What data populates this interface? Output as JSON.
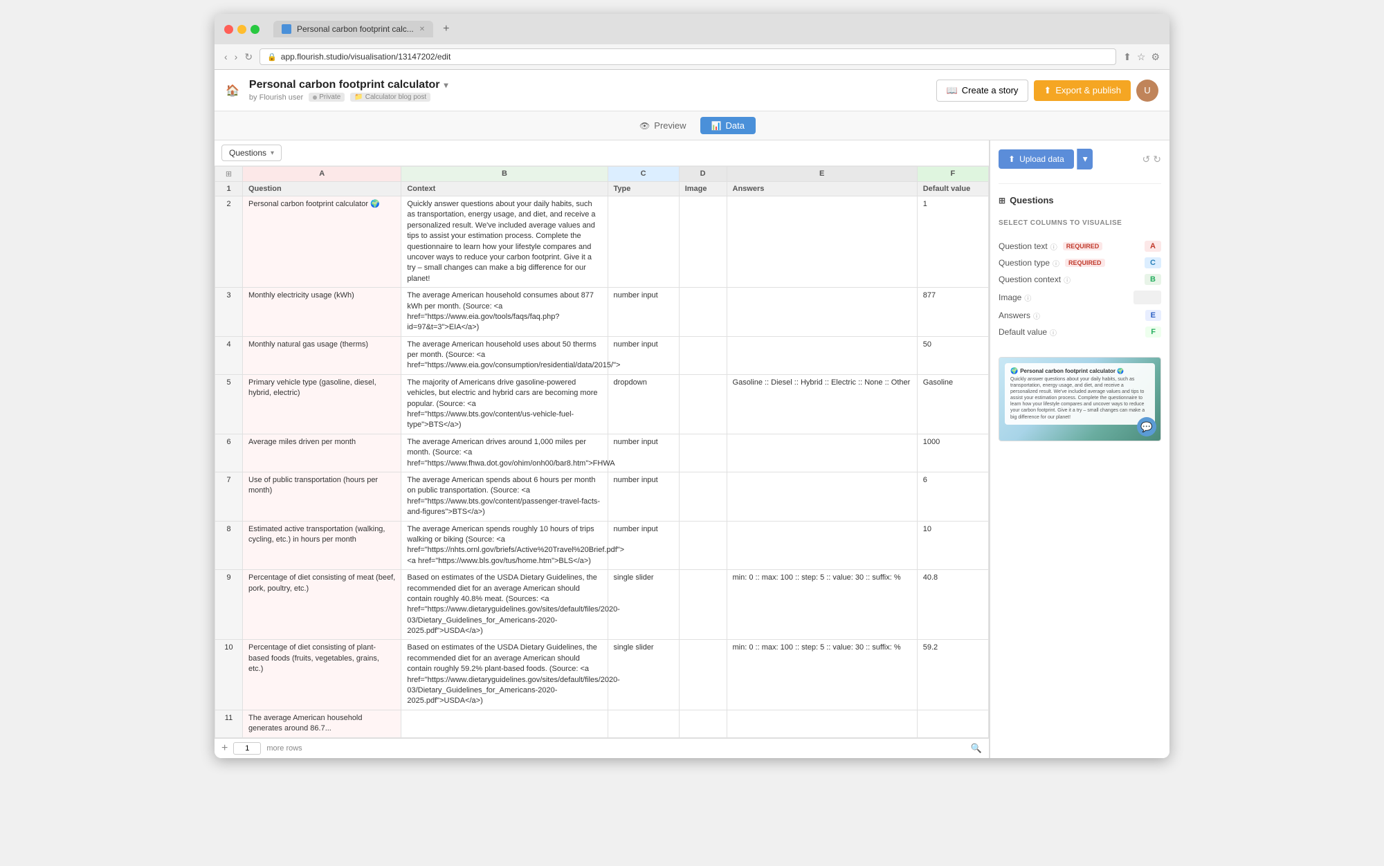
{
  "browser": {
    "url": "app.flourish.studio/visualisation/13147202/edit",
    "tab_title": "Personal carbon footprint calc...",
    "traffic_lights": [
      "red",
      "yellow",
      "green"
    ]
  },
  "header": {
    "project_title": "Personal carbon footprint calculator",
    "by_label": "by Flourish user",
    "private_badge": "Private",
    "folder_badge": "Calculator blog post",
    "create_story_label": "Create a story",
    "export_publish_label": "Export & publish"
  },
  "view_tabs": [
    {
      "id": "preview",
      "label": "Preview",
      "icon": "👁"
    },
    {
      "id": "data",
      "label": "Data",
      "icon": "📊",
      "active": true
    }
  ],
  "sheet_selector": {
    "label": "Questions",
    "arrow": "▾"
  },
  "columns": [
    {
      "id": "row_num",
      "label": ""
    },
    {
      "id": "A",
      "label": "A"
    },
    {
      "id": "B",
      "label": "B"
    },
    {
      "id": "C",
      "label": "C"
    },
    {
      "id": "D",
      "label": "D"
    },
    {
      "id": "E",
      "label": "E"
    },
    {
      "id": "F",
      "label": "F"
    }
  ],
  "header_row": {
    "row_num": "1",
    "A": "Question",
    "B": "Context",
    "C": "Type",
    "D": "Image",
    "E": "Answers",
    "F": "Default value"
  },
  "rows": [
    {
      "num": "2",
      "A": "Personal carbon footprint calculator 🌍",
      "B": "Quickly answer questions about your daily habits, such as transportation, energy usage, and diet, and receive a personalized result. We've included average values and tips to assist your estimation process. Complete the questionnaire to learn how your lifestyle compares and uncover ways to reduce your carbon footprint. Give it a try – small changes can make a big difference for our planet!",
      "C": "",
      "D": "",
      "E": "",
      "F": "1"
    },
    {
      "num": "3",
      "A": "Monthly electricity usage (kWh)",
      "B": "The average American household consumes about 877 kWh per month. (Source: <a href=\"https://www.eia.gov/tools/faqs/faq.php?id=97&t=3\">EIA</a>)",
      "C": "number input",
      "D": "",
      "E": "",
      "F": "877"
    },
    {
      "num": "4",
      "A": "Monthly natural gas usage (therms)",
      "B": "The average American household uses about 50 therms per month. (Source: <a href=\"https://www.eia.gov/consumption/residential/data/2015/\">",
      "C": "number input",
      "D": "",
      "E": "",
      "F": "50"
    },
    {
      "num": "5",
      "A": "Primary vehicle type (gasoline, diesel, hybrid, electric)",
      "B": "The majority of Americans drive gasoline-powered vehicles, but electric and hybrid cars are becoming more popular. (Source: <a href=\"https://www.bts.gov/content/us-vehicle-fuel-type\">BTS</a>)",
      "C": "dropdown",
      "D": "",
      "E": "Gasoline :: Diesel :: Hybrid :: Electric :: None :: Other",
      "F": "Gasoline"
    },
    {
      "num": "6",
      "A": "Average miles driven per month",
      "B": "The average American drives around 1,000 miles per month. (Source: <a href=\"https://www.fhwa.dot.gov/ohim/onh00/bar8.htm\">FHWA",
      "C": "number input",
      "D": "",
      "E": "",
      "F": "1000"
    },
    {
      "num": "7",
      "A": "Use of public transportation (hours per month)",
      "B": "The average American spends about 6 hours per month on public transportation. (Source: <a href=\"https://www.bts.gov/content/passenger-travel-facts-and-figures\">BTS</a>)",
      "C": "number input",
      "D": "",
      "E": "",
      "F": "6"
    },
    {
      "num": "8",
      "A": "Estimated active transportation (walking, cycling, etc.) in hours per month",
      "B": "The average American spends roughly 10 hours of trips walking or biking (Source: <a href=\"https://nhts.ornl.gov/briefs/Active%20Travel%20Brief.pdf\"><a href=\"https://www.bls.gov/tus/home.htm\">BLS</a>)",
      "C": "number input",
      "D": "",
      "E": "",
      "F": "10"
    },
    {
      "num": "9",
      "A": "Percentage of diet consisting of meat (beef, pork, poultry, etc.)",
      "B": "Based on estimates of the USDA Dietary Guidelines, the recommended diet for an average American should contain roughly 40.8% meat. (Sources: <a href=\"https://www.dietaryguidelines.gov/sites/default/files/2020-03/Dietary_Guidelines_for_Americans-2020-2025.pdf\">USDA</a>)",
      "C": "single slider",
      "D": "",
      "E": "min: 0 :: max: 100 :: step: 5 :: value: 30 :: suffix: %",
      "F": "40.8"
    },
    {
      "num": "10",
      "A": "Percentage of diet consisting of plant-based foods (fruits, vegetables, grains, etc.)",
      "B": "Based on estimates of the USDA Dietary Guidelines, the recommended diet for an average American should contain roughly 59.2% plant-based foods. (Source: <a href=\"https://www.dietaryguidelines.gov/sites/default/files/2020-03/Dietary_Guidelines_for_Americans-2020-2025.pdf\">USDA</a>)",
      "C": "single slider",
      "D": "",
      "E": "min: 0 :: max: 100 :: step: 5 :: value: 30 :: suffix: %",
      "F": "59.2"
    },
    {
      "num": "11",
      "A": "The average American household generates around 86.7...",
      "B": "",
      "C": "",
      "D": "",
      "E": "",
      "F": ""
    }
  ],
  "bottom_bar": {
    "add_icon": "+",
    "row_count": "1",
    "more_rows_label": "more rows"
  },
  "right_panel": {
    "upload_data_label": "Upload data",
    "section_title": "Questions",
    "select_columns_label": "SELECT COLUMNS TO VISUALISE",
    "fields": [
      {
        "label": "Question text",
        "required": true,
        "badge": "A",
        "badge_class": "col-badge-a",
        "info": true
      },
      {
        "label": "Question type",
        "required": true,
        "badge": "C",
        "badge_class": "col-badge-c",
        "info": true
      },
      {
        "label": "Question context",
        "required": false,
        "badge": "B",
        "badge_class": "col-badge-b",
        "info": true
      },
      {
        "label": "Image",
        "required": false,
        "badge": "",
        "badge_class": "col-badge-empty",
        "info": true
      },
      {
        "label": "Answers",
        "required": false,
        "badge": "E",
        "badge_class": "col-badge-e",
        "info": true
      },
      {
        "label": "Default value",
        "required": false,
        "badge": "F",
        "badge_class": "col-badge-f",
        "info": true
      }
    ],
    "preview": {
      "title": "Personal carbon footprint calculator 🌍",
      "text": "Quickly answer questions about your daily habits, such as transportation, energy usage, and diet, and receive a personalized result. We've included average values and tips to assist your estimation process. Complete the questionnaire to learn how your lifestyle compares and uncover ways to reduce your carbon footprint. Give it a try – small changes can make a big difference for our planet!"
    }
  }
}
